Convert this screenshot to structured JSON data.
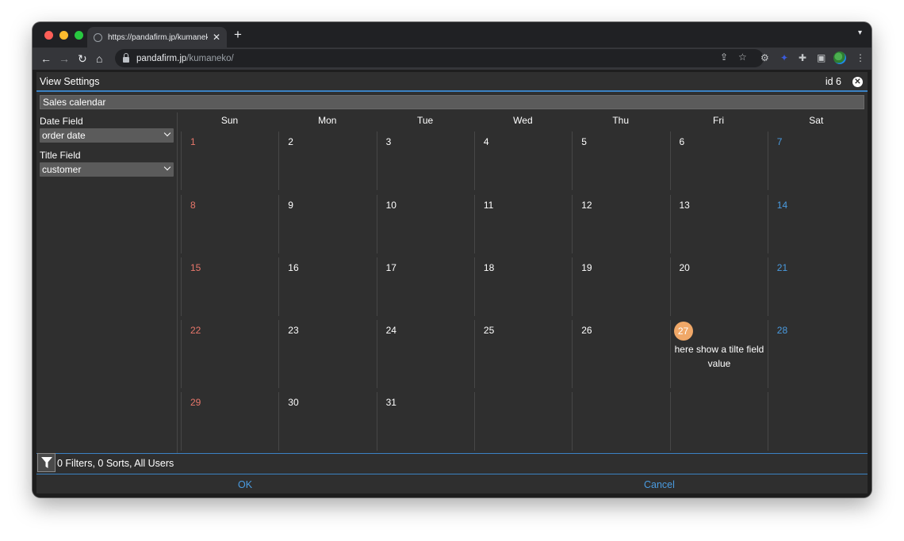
{
  "browser": {
    "tab_title": "https://pandafirm.jp/kumaneko/",
    "url_host": "pandafirm.jp",
    "url_path": "/kumaneko/"
  },
  "dialog": {
    "title": "View Settings",
    "id_label": "id 6",
    "view_name": "Sales calendar"
  },
  "sidebar": {
    "date_field_label": "Date Field",
    "date_field_value": "order date",
    "title_field_label": "Title Field",
    "title_field_value": "customer"
  },
  "calendar": {
    "weekdays": [
      "Sun",
      "Mon",
      "Tue",
      "Wed",
      "Thu",
      "Fri",
      "Sat"
    ],
    "weeks": [
      [
        "1",
        "2",
        "3",
        "4",
        "5",
        "6",
        "7"
      ],
      [
        "8",
        "9",
        "10",
        "11",
        "12",
        "13",
        "14"
      ],
      [
        "15",
        "16",
        "17",
        "18",
        "19",
        "20",
        "21"
      ],
      [
        "22",
        "23",
        "24",
        "25",
        "26",
        "27",
        "28"
      ],
      [
        "29",
        "30",
        "31",
        "",
        "",
        "",
        ""
      ]
    ],
    "highlighted_day": "27",
    "event_text": "here show a tilte field value"
  },
  "footer": {
    "filter_summary": "0 Filters, 0 Sorts, All Users",
    "ok_label": "OK",
    "cancel_label": "Cancel"
  },
  "colors": {
    "sunday": "#e8776b",
    "saturday": "#4a9be0",
    "highlight": "#f0a868",
    "accent": "#3b82c4"
  }
}
